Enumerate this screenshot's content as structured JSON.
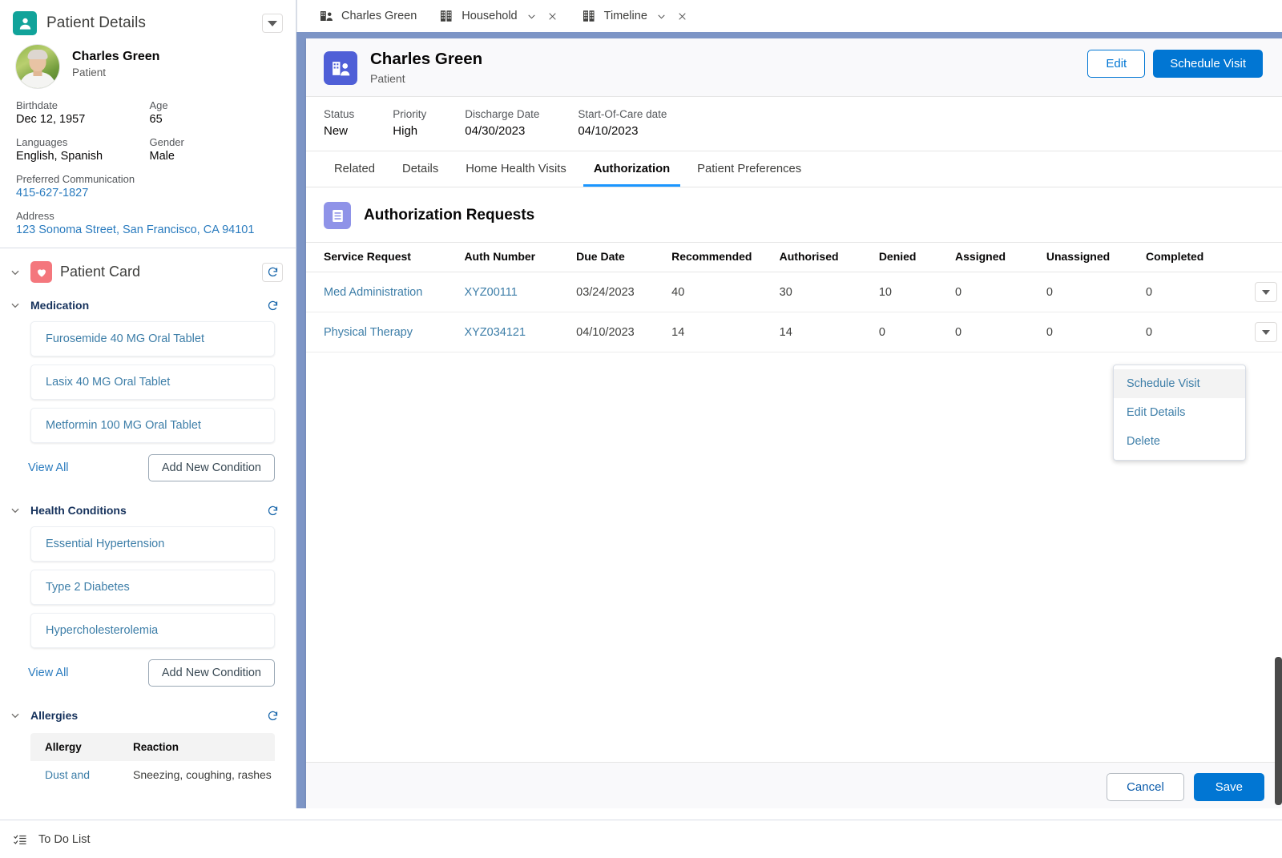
{
  "window_tabs": [
    {
      "label": "Charles Green",
      "icon": "person-building-icon",
      "has_menu": false,
      "has_close": false
    },
    {
      "label": "Household",
      "icon": "building-icon",
      "has_menu": true,
      "has_close": true
    },
    {
      "label": "Timeline",
      "icon": "building-icon",
      "has_menu": true,
      "has_close": true
    }
  ],
  "sidebar": {
    "panel_title": "Patient Details",
    "panel_icon": "person-icon",
    "panel_caret_icon": "caret-down-icon",
    "patient": {
      "name": "Charles Green",
      "role": "Patient",
      "fields": [
        {
          "label": "Birthdate",
          "value": "Dec 12, 1957",
          "link": false
        },
        {
          "label": "Age",
          "value": "65",
          "link": false
        },
        {
          "label": "Languages",
          "value": "English, Spanish",
          "link": false
        },
        {
          "label": "Gender",
          "value": "Male",
          "link": false
        },
        {
          "label": "Preferred Communication",
          "value": "415-627-1827",
          "link": true
        },
        {
          "label": "Address",
          "value": "123 Sonoma Street, San Francisco, CA 94101",
          "link": true
        }
      ]
    },
    "patient_card": {
      "title": "Patient Card",
      "icon": "heart-icon",
      "refresh_icon": "refresh-icon",
      "chevron_icon": "chevron-down-icon"
    },
    "sections": [
      {
        "title": "Medication",
        "items": [
          "Furosemide 40 MG Oral Tablet",
          "Lasix 40 MG Oral Tablet",
          "Metformin 100 MG Oral Tablet"
        ],
        "view_all": "View All",
        "add_button": "Add New Condition"
      },
      {
        "title": "Health Conditions",
        "items": [
          "Essential Hypertension",
          "Type 2 Diabetes",
          "Hypercholesterolemia"
        ],
        "view_all": "View All",
        "add_button": "Add New Condition"
      }
    ],
    "allergies": {
      "title": "Allergies",
      "columns": [
        "Allergy",
        "Reaction"
      ],
      "rows": [
        {
          "allergy": "Dust and",
          "reaction": "Sneezing, coughing, rashes"
        }
      ]
    }
  },
  "todo": {
    "label": "To Do List",
    "icon": "checklist-icon"
  },
  "record": {
    "icon": "person-building-icon",
    "name": "Charles Green",
    "subtitle": "Patient",
    "edit_label": "Edit",
    "schedule_label": "Schedule Visit",
    "fields": [
      {
        "label": "Status",
        "value": "New"
      },
      {
        "label": "Priority",
        "value": "High"
      },
      {
        "label": "Discharge Date",
        "value": "04/30/2023"
      },
      {
        "label": "Start-Of-Care date",
        "value": "04/10/2023"
      }
    ],
    "tabs": [
      {
        "label": "Related",
        "active": false
      },
      {
        "label": "Details",
        "active": false
      },
      {
        "label": "Home Health Visits",
        "active": false
      },
      {
        "label": "Authorization",
        "active": true
      },
      {
        "label": "Patient Preferences",
        "active": false
      }
    ]
  },
  "auth_section": {
    "title": "Authorization Requests",
    "icon": "document-icon",
    "columns": [
      "Service Request",
      "Auth Number",
      "Due Date",
      "Recommended",
      "Authorised",
      "Denied",
      "Assigned",
      "Unassigned",
      "Completed"
    ],
    "rows": [
      {
        "service_request": "Med Administration",
        "auth_number": "XYZ00111",
        "due_date": "03/24/2023",
        "recommended": "40",
        "authorised": "30",
        "denied": "10",
        "assigned": "0",
        "unassigned": "0",
        "completed": "0"
      },
      {
        "service_request": "Physical Therapy",
        "auth_number": "XYZ034121",
        "due_date": "04/10/2023",
        "recommended": "14",
        "authorised": "14",
        "denied": "0",
        "assigned": "0",
        "unassigned": "0",
        "completed": "0"
      }
    ],
    "row_action_icon": "caret-down-icon"
  },
  "row_menu": {
    "items": [
      "Schedule Visit",
      "Edit Details",
      "Delete"
    ],
    "hovered_index": 0
  },
  "footer": {
    "cancel_label": "Cancel",
    "save_label": "Save"
  },
  "colors": {
    "brand_blue": "#0176D3",
    "link_blue": "#3D7EA8",
    "teal_icon": "#11A39A",
    "heart_red": "#F4777D",
    "record_icon_purple": "#4F5FD7",
    "auth_icon_purple": "#8F93E8",
    "background_band": "#7D95C6",
    "active_tab_underline": "#1B96FF"
  }
}
